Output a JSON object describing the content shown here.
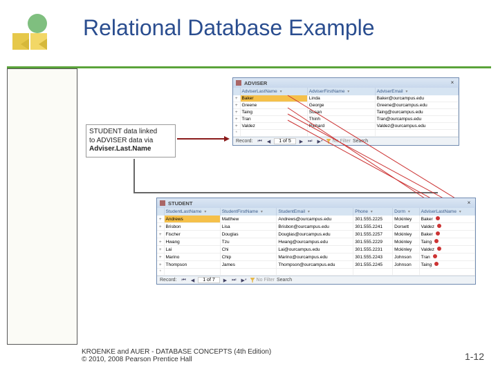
{
  "slide": {
    "title": "Relational Database Example",
    "footer1": "KROENKE and AUER - DATABASE CONCEPTS (4th Edition)",
    "footer2": "© 2010, 2008 Pearson Prentice Hall",
    "page": "1-12"
  },
  "note": {
    "line1": "STUDENT data linked",
    "line2": "to ADVISER data via",
    "line3": "Adviser.Last.Name"
  },
  "adviser": {
    "name": "ADVISER",
    "headers": [
      "",
      "AdviserLastName",
      "AdviserFirstName",
      "AdviserEmail"
    ],
    "rows": [
      [
        "+",
        "Baker",
        "Linda",
        "Baker@ourcampus.edu"
      ],
      [
        "+",
        "Greene",
        "George",
        "Greene@ourcampus.edu"
      ],
      [
        "+",
        "Taing",
        "Susan",
        "Taing@ourcampus.edu"
      ],
      [
        "+",
        "Tran",
        "Thinh",
        "Tran@ourcampus.edu"
      ],
      [
        "+",
        "Valdez",
        "Richard",
        "Valdez@ourcampus.edu"
      ]
    ],
    "nav": {
      "label": "Record:",
      "count": "1 of 5",
      "filter": "No Filter",
      "search": "Search"
    }
  },
  "student": {
    "name": "STUDENT",
    "headers": [
      "",
      "StudentLastName",
      "StudentFirstName",
      "StudentEmail",
      "Phone",
      "Dorm",
      "AdviserLastName"
    ],
    "rows": [
      [
        "+",
        "Andrews",
        "Matthew",
        "Andrews@ourcampus.edu",
        "301.555.2225",
        "Mckinley",
        "Baker"
      ],
      [
        "+",
        "Brisbon",
        "Lisa",
        "Brisbon@ourcampus.edu",
        "301.555.2241",
        "Dorsett",
        "Valdez"
      ],
      [
        "+",
        "Fischer",
        "Douglas",
        "Douglas@ourcampus.edu",
        "301.555.2257",
        "Mckinley",
        "Baker"
      ],
      [
        "+",
        "Hwang",
        "Tzu",
        "Hwang@ourcampus.edu",
        "301.555.2229",
        "Mckinley",
        "Taing"
      ],
      [
        "+",
        "Lai",
        "Chi",
        "Lai@ourcampus.edu",
        "301.555.2231",
        "Mckinley",
        "Valdez"
      ],
      [
        "+",
        "Marino",
        "Chip",
        "Marino@ourcampus.edu",
        "301.555.2243",
        "Johnson",
        "Tran"
      ],
      [
        "+",
        "Thompson",
        "James",
        "Thompson@ourcampus.edu",
        "301.555.2245",
        "Johnson",
        "Taing"
      ]
    ],
    "nav": {
      "label": "Record:",
      "count": "1 of 7",
      "filter": "No Filter",
      "search": "Search"
    }
  }
}
